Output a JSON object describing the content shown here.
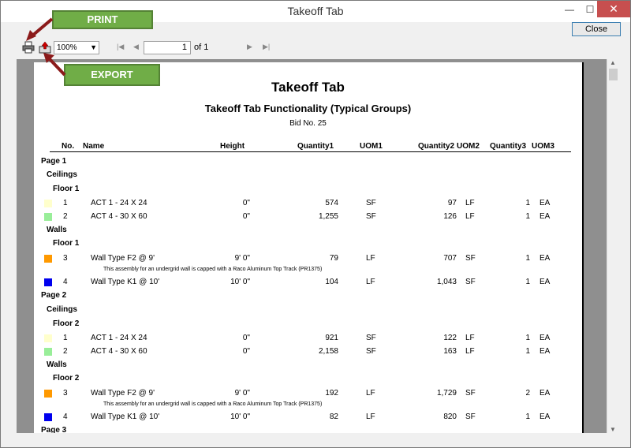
{
  "window": {
    "title": "Takeoff Tab",
    "minimize": "—",
    "maximize": "☐",
    "close": "✕"
  },
  "close_button": "Close",
  "toolbar": {
    "zoom": "100%",
    "page_value": "1",
    "of_text": "of 1"
  },
  "callouts": {
    "print": "PRINT",
    "export": "EXPORT"
  },
  "report": {
    "title": "Takeoff Tab",
    "subtitle": "Takeoff Tab Functionality (Typical Groups)",
    "bid": "Bid No. 25",
    "headers": {
      "no": "No.",
      "name": "Name",
      "height": "Height",
      "q1": "Quantity1",
      "u1": "UOM1",
      "q2": "Quantity2",
      "u2": "UOM2",
      "q3": "Quantity3",
      "u3": "UOM3"
    },
    "labels": {
      "page1": "Page 1",
      "page2": "Page 2",
      "page3": "Page 3",
      "ceilings": "Ceilings",
      "walls": "Walls",
      "floor1": "Floor 1",
      "floor2": "Floor 2"
    },
    "note": "This assembly for an undergrid wall is capped with a Raco Aluminum Top Track (PR1375)",
    "rows": [
      {
        "no": "1",
        "name": "ACT 1 - 24 X 24",
        "height": "0\"",
        "q1": "574",
        "u1": "SF",
        "q2": "97",
        "u2": "LF",
        "q3": "1",
        "u3": "EA",
        "color": "#ffffcc"
      },
      {
        "no": "2",
        "name": "ACT 4 - 30 X 60",
        "height": "0\"",
        "q1": "1,255",
        "u1": "SF",
        "q2": "126",
        "u2": "LF",
        "q3": "1",
        "u3": "EA",
        "color": "#99ee99"
      },
      {
        "no": "3",
        "name": "Wall Type F2 @ 9'",
        "height": "9' 0\"",
        "q1": "79",
        "u1": "LF",
        "q2": "707",
        "u2": "SF",
        "q3": "1",
        "u3": "EA",
        "color": "#ff9900"
      },
      {
        "no": "4",
        "name": "Wall Type K1 @ 10'",
        "height": "10' 0\"",
        "q1": "104",
        "u1": "LF",
        "q2": "1,043",
        "u2": "SF",
        "q3": "1",
        "u3": "EA",
        "color": "#0000ee"
      },
      {
        "no": "1",
        "name": "ACT 1 - 24 X 24",
        "height": "0\"",
        "q1": "921",
        "u1": "SF",
        "q2": "122",
        "u2": "LF",
        "q3": "1",
        "u3": "EA",
        "color": "#ffffcc"
      },
      {
        "no": "2",
        "name": "ACT 4 - 30 X 60",
        "height": "0\"",
        "q1": "2,158",
        "u1": "SF",
        "q2": "163",
        "u2": "LF",
        "q3": "1",
        "u3": "EA",
        "color": "#99ee99"
      },
      {
        "no": "3",
        "name": "Wall Type F2 @ 9'",
        "height": "9' 0\"",
        "q1": "192",
        "u1": "LF",
        "q2": "1,729",
        "u2": "SF",
        "q3": "2",
        "u3": "EA",
        "color": "#ff9900"
      },
      {
        "no": "4",
        "name": "Wall Type K1 @ 10'",
        "height": "10' 0\"",
        "q1": "82",
        "u1": "LF",
        "q2": "820",
        "u2": "SF",
        "q3": "1",
        "u3": "EA",
        "color": "#0000ee"
      }
    ]
  },
  "icons": {
    "print": "printer-icon",
    "export": "export-icon",
    "first": "first-page-icon",
    "prev": "prev-page-icon",
    "next": "next-page-icon",
    "last": "last-page-icon"
  }
}
